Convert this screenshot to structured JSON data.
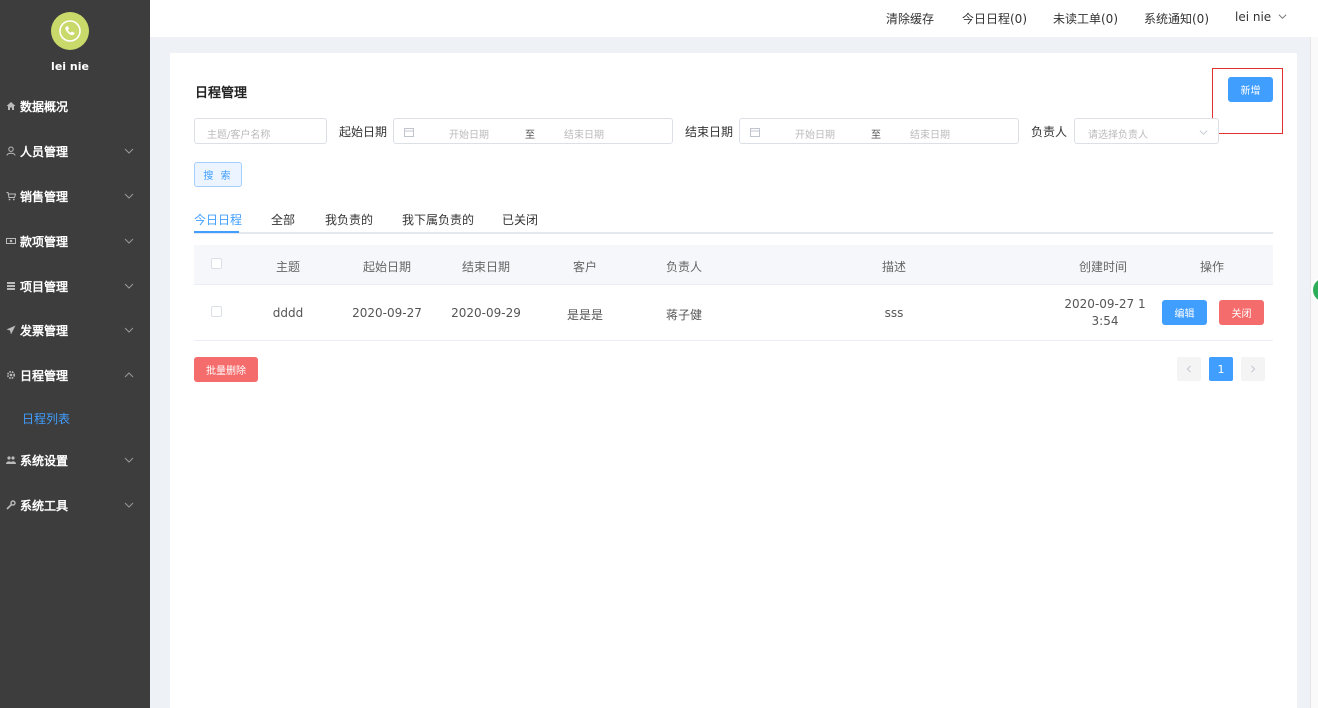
{
  "user": {
    "name": "lei nie"
  },
  "sidebar": {
    "items": [
      {
        "label": "数据概况",
        "icon": "home-icon"
      },
      {
        "label": "人员管理",
        "icon": "user-icon"
      },
      {
        "label": "销售管理",
        "icon": "cart-icon"
      },
      {
        "label": "款项管理",
        "icon": "money-icon"
      },
      {
        "label": "项目管理",
        "icon": "list-icon"
      },
      {
        "label": "发票管理",
        "icon": "send-icon"
      },
      {
        "label": "日程管理",
        "icon": "gear-icon",
        "expanded": true
      },
      {
        "label": "系统设置",
        "icon": "users-icon"
      },
      {
        "label": "系统工具",
        "icon": "wrench-icon"
      }
    ],
    "sub_active": "日程列表"
  },
  "topbar": {
    "clear_cache": "清除缓存",
    "today_schedule": "今日日程(0)",
    "unread_orders": "未读工单(0)",
    "sys_notice": "系统通知(0)",
    "user_menu": "lei nie"
  },
  "page": {
    "title": "日程管理",
    "new_button": "新增"
  },
  "filters": {
    "keyword_placeholder": "主题/客户名称",
    "start_date_label": "起始日期",
    "end_date_label": "结束日期",
    "range_start_placeholder": "开始日期",
    "range_end_placeholder": "结束日期",
    "range_sep": "至",
    "owner_label": "负责人",
    "owner_placeholder": "请选择负责人",
    "search_button": "搜 索"
  },
  "tabs": [
    "今日日程",
    "全部",
    "我负责的",
    "我下属负责的",
    "已关闭"
  ],
  "table": {
    "headers": [
      "主题",
      "起始日期",
      "结束日期",
      "客户",
      "负责人",
      "描述",
      "创建时间",
      "操作"
    ],
    "rows": [
      {
        "subject": "dddd",
        "start": "2020-09-27",
        "end": "2020-09-29",
        "customer": "是是是",
        "owner": "蒋子健",
        "desc": "sss",
        "created_line1": "2020-09-27 1",
        "created_line2": "3:54",
        "edit": "编辑",
        "close": "关闭"
      }
    ]
  },
  "batch_delete": "批量删除",
  "pagination": {
    "current": "1"
  },
  "colors": {
    "primary": "#409eff",
    "danger": "#f56c6c",
    "sidebar_bg": "#3d3d3d"
  }
}
